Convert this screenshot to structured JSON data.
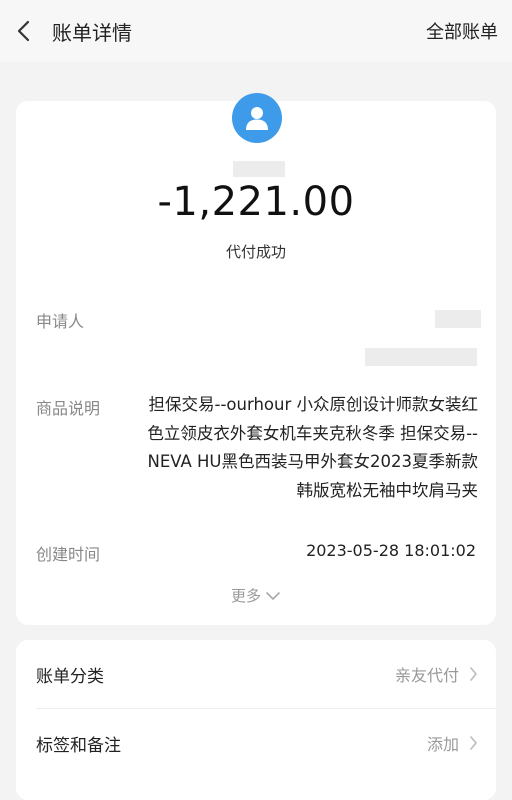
{
  "header": {
    "title": "账单详情",
    "all_bills": "全部账单"
  },
  "summary": {
    "amount": "-1,221.00",
    "status": "代付成功"
  },
  "details": {
    "applicant_label": "申请人",
    "product_label": "商品说明",
    "product_text": "担保交易--ourhour 小众原创设计师款女装红色立领皮衣外套女机车夹克秋冬季 担保交易--NEVA HU黑色西装马甲外套女2023夏季新款韩版宽松无袖中坎肩马夹",
    "created_label": "创建时间",
    "created_value": "2023-05-28 18:01:02",
    "more": "更多"
  },
  "settings": {
    "category_label": "账单分类",
    "category_value": "亲友代付",
    "tags_label": "标签和备注",
    "tags_value": "添加"
  },
  "icons": {
    "back": "back-arrow-icon",
    "avatar": "user-avatar-icon",
    "more": "chevron-down-icon",
    "row_arrow": "chevron-right-icon"
  },
  "colors": {
    "avatar_bg": "#3d9bea",
    "page_bg": "#f3f3f3"
  }
}
